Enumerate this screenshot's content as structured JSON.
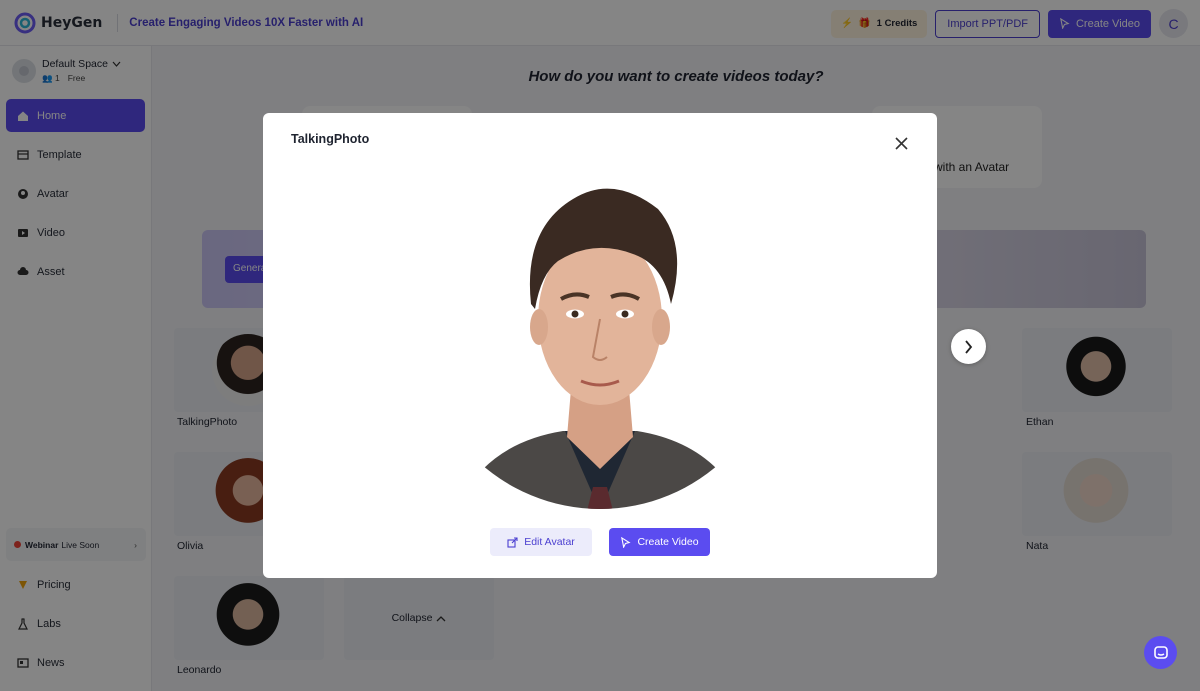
{
  "header": {
    "logo_text": "HeyGen",
    "tagline": "Create Engaging Videos 10X Faster with AI",
    "credits_label": "1 Credits",
    "import_label": "Import PPT/PDF",
    "create_video_label": "Create Video",
    "user_initial": "C"
  },
  "sidebar": {
    "space_name": "Default Space",
    "member_count": "1",
    "plan": "Free",
    "items": [
      {
        "label": "Home",
        "icon": "home-icon",
        "active": true
      },
      {
        "label": "Template",
        "icon": "template-icon"
      },
      {
        "label": "Avatar",
        "icon": "avatar-icon"
      },
      {
        "label": "Video",
        "icon": "video-icon"
      },
      {
        "label": "Asset",
        "icon": "asset-icon"
      }
    ],
    "webinar_bold": "Webinar",
    "webinar_text": "Live Soon",
    "bottom_items": [
      {
        "label": "Pricing",
        "icon": "pricing-icon"
      },
      {
        "label": "Labs",
        "icon": "labs-icon"
      },
      {
        "label": "News",
        "icon": "news-icon"
      }
    ]
  },
  "main": {
    "heading": "How do you want to create videos today?",
    "avatar_card_text": "with an Avatar",
    "banner_button": "Generate",
    "cards": [
      {
        "label": "TalkingPhoto"
      },
      {
        "label": "Ethan"
      },
      {
        "label": "Olivia"
      },
      {
        "label": "Nata"
      },
      {
        "label": "Leonardo"
      }
    ],
    "collapse_label": "Collapse"
  },
  "modal": {
    "title": "TalkingPhoto",
    "edit_label": "Edit Avatar",
    "create_label": "Create Video"
  },
  "colors": {
    "accent": "#5b4cf0",
    "accent_dark": "#4b3fd0",
    "overlay": "rgba(0,0,0,0.48)"
  }
}
